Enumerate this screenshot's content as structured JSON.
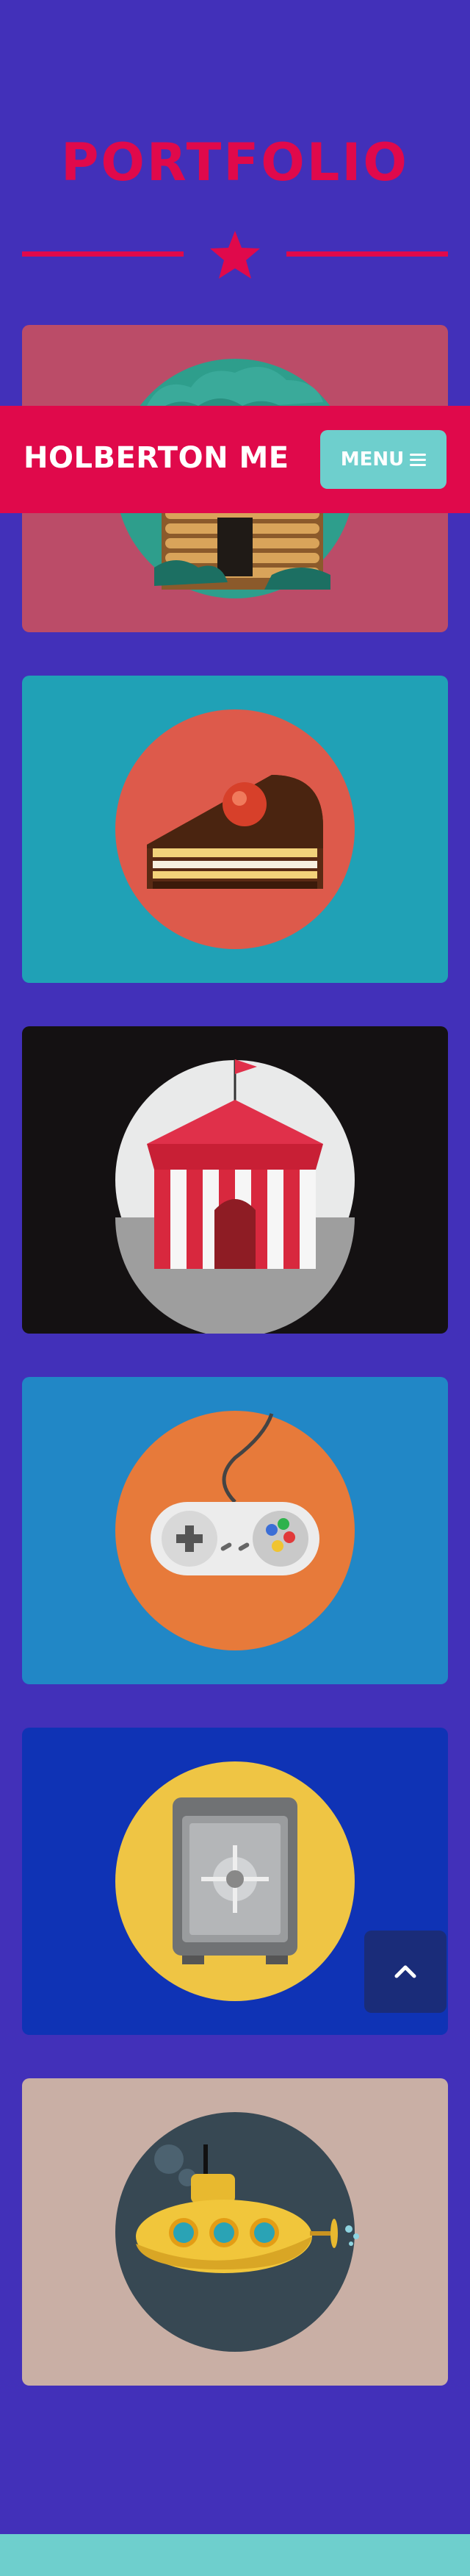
{
  "section": {
    "title": "PORTFOLIO"
  },
  "navbar": {
    "brand": "HOLBERTON ME",
    "menu_label": "MENU"
  },
  "colors": {
    "background": "#4230b9",
    "accent": "#e0094b",
    "teal": "#6ecfcd",
    "back_to_top": "#1a2c79"
  },
  "portfolio_items": [
    {
      "icon": "log-cabin-icon",
      "background": "#bb4c68",
      "circle": "#2e9e8c"
    },
    {
      "icon": "cake-slice-icon",
      "background": "#20a1b6",
      "circle": "#dd5a4b"
    },
    {
      "icon": "circus-tent-icon",
      "background": "#141112",
      "circle": "#e9eaea"
    },
    {
      "icon": "game-controller-icon",
      "background": "#2187c6",
      "circle": "#e77a3a"
    },
    {
      "icon": "safe-icon",
      "background": "#0f33b5",
      "circle": "#efc544"
    },
    {
      "icon": "submarine-icon",
      "background": "#c9afa5",
      "circle": "#374853"
    }
  ],
  "back_to_top": {
    "icon": "chevron-up-icon"
  }
}
